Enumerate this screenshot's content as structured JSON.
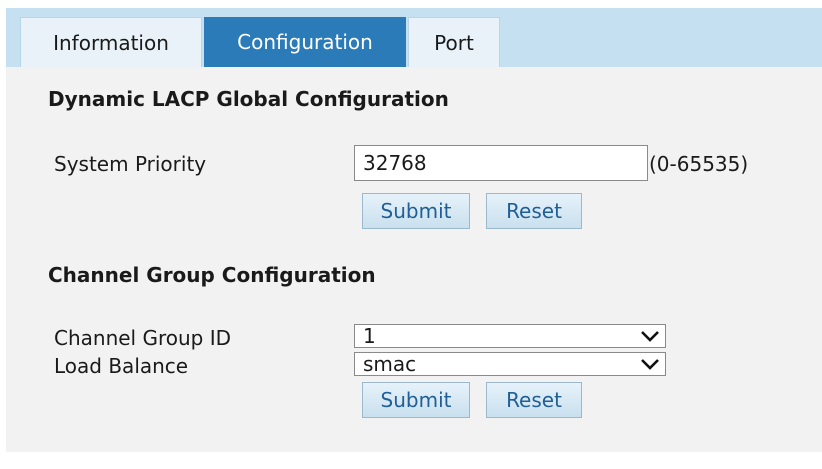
{
  "tabs": [
    {
      "label": "Information",
      "active": false
    },
    {
      "label": "Configuration",
      "active": true
    },
    {
      "label": "Port",
      "active": false
    }
  ],
  "lacp_global": {
    "title": "Dynamic LACP Global Configuration",
    "system_priority_label": "System Priority",
    "system_priority_value": "32768",
    "range_hint": "(0-65535)",
    "submit_label": "Submit",
    "reset_label": "Reset"
  },
  "channel_group": {
    "title": "Channel Group Configuration",
    "group_id_label": "Channel Group ID",
    "group_id_value": "1",
    "load_balance_label": "Load Balance",
    "load_balance_value": "smac",
    "submit_label": "Submit",
    "reset_label": "Reset"
  },
  "colors": {
    "tab_bar": "#c5e1f1",
    "active_tab": "#2b7bb9",
    "panel_bg": "#f2f2f2",
    "button_text": "#1f5f96"
  },
  "icons": {
    "dropdown": "chevron-down-icon"
  }
}
